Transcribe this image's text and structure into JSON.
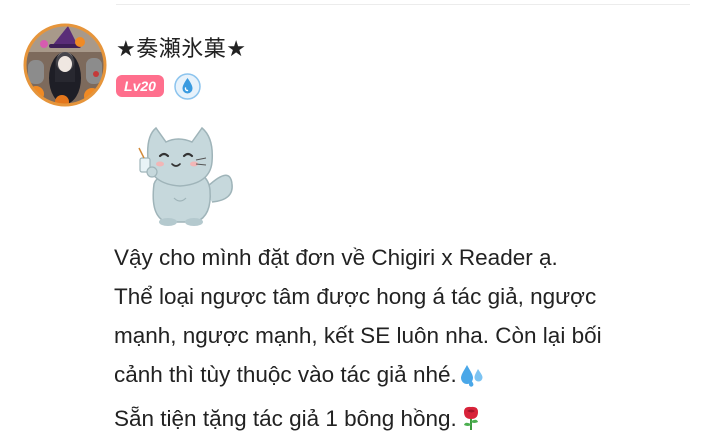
{
  "user": {
    "name": "★奏瀬氷菓★",
    "level": "Lv20",
    "avatar_icon": "halloween-avatar-icon",
    "role_icon": "water-drop-badge-icon"
  },
  "post": {
    "sticker_icon": "gray-cat-sticker-icon",
    "lines": [
      "Vậy cho mình đặt đơn về Chigiri x Reader ạ.",
      "Thể loại ngược tâm được hong á tác giả, ngược",
      "mạnh, ngược mạnh, kết SE luôn nha. Còn lại bối",
      "cảnh thì tùy thuộc vào tác giả nhé.",
      "Sẵn tiện tặng tác giả 1 bông hồng."
    ],
    "emojis": {
      "line4": "sweat-droplets-icon",
      "line5": "rose-icon"
    }
  },
  "colors": {
    "level_badge": "#ff6f8d",
    "role_badge": "#3a9be0",
    "text": "#222222"
  }
}
